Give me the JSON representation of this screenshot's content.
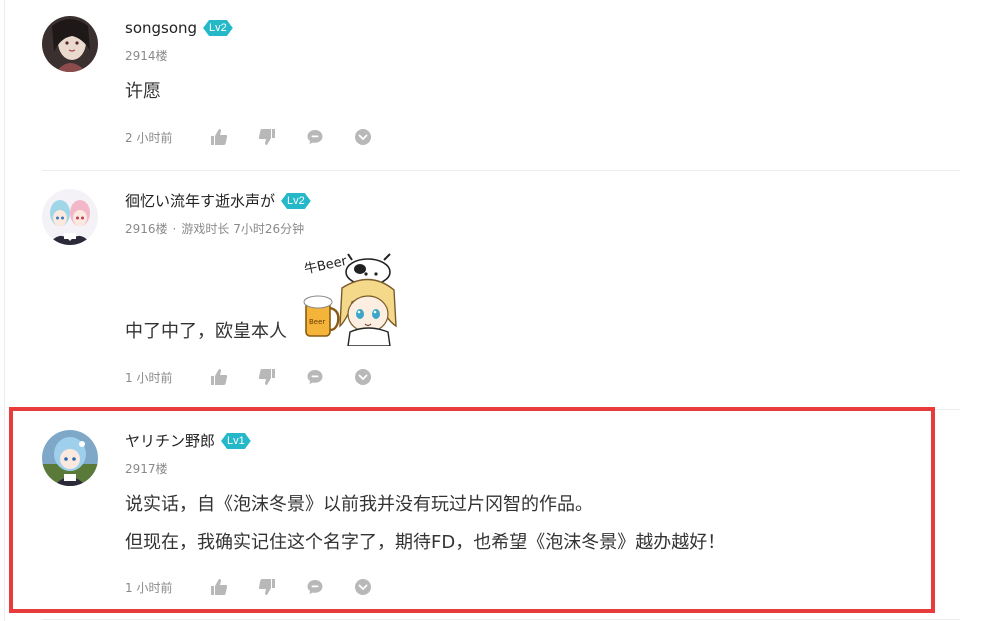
{
  "comments": [
    {
      "username": "songsong",
      "level": "Lv2",
      "floor": "2914楼",
      "playtime": "",
      "lines": [
        "许愿"
      ],
      "time": "2 小时前"
    },
    {
      "username": "徊忆い流年す逝水声が",
      "level": "Lv2",
      "floor": "2916楼",
      "meta_sep": "·",
      "playtime": "游戏时长 7小时26分钟",
      "lines": [
        "中了中了，欧皇本人"
      ],
      "sticker_text": "牛Beer",
      "time": "1 小时前"
    },
    {
      "username": "ヤリチン野郎",
      "level": "Lv1",
      "floor": "2917楼",
      "playtime": "",
      "lines": [
        "说实话，自《泡沫冬景》以前我并没有玩过片冈智的作品。",
        "但现在，我确实记住这个名字了，期待FD，也希望《泡沫冬景》越办越好！"
      ],
      "time": "1 小时前"
    }
  ],
  "icons": {
    "like": "thumbs-up-icon",
    "dislike": "thumbs-down-icon",
    "reply": "comment-bubble-icon",
    "more": "chevron-down-circle-icon"
  },
  "colors": {
    "level_badge": "#25b8c9",
    "highlight": "#e83c3c",
    "icon_gray": "#b8b8b8",
    "meta_gray": "#8a8a8a"
  }
}
